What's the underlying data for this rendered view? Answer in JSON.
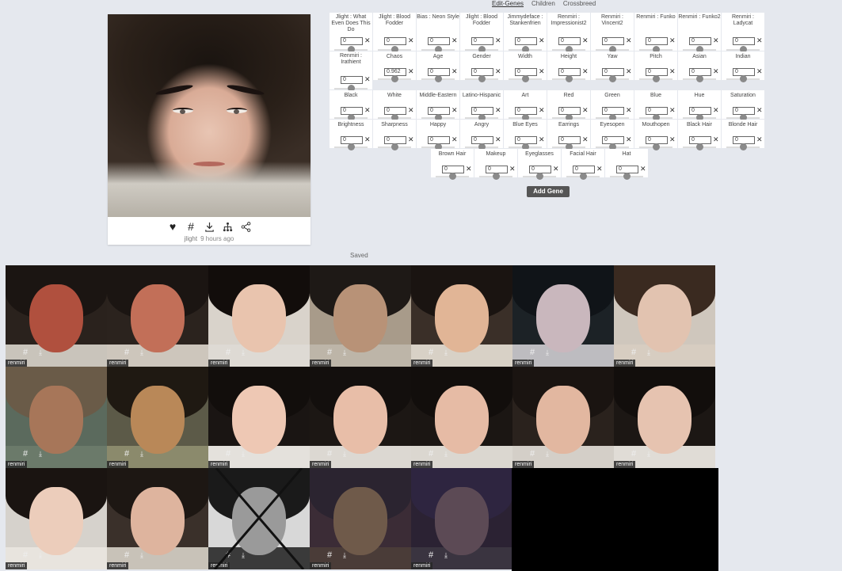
{
  "tabs": [
    {
      "label": "Edit-Genes",
      "active": true
    },
    {
      "label": "Children",
      "active": false
    },
    {
      "label": "Crossbreed",
      "active": false
    }
  ],
  "card": {
    "user": "jlight",
    "time": "9 hours ago",
    "icons": [
      "heart-icon",
      "hash-icon",
      "download-icon",
      "tree-icon",
      "share-icon"
    ]
  },
  "genes": {
    "row1": [
      {
        "label": "Jlight : What Even Does This Do",
        "value": "0",
        "knob": 0.5
      },
      {
        "label": "Jlight : Blood Fodder",
        "value": "0",
        "knob": 0.5
      },
      {
        "label": "Bias : Neon Style",
        "value": "0",
        "knob": 0.5
      },
      {
        "label": "Jlight : Blood Fodder",
        "value": "0",
        "knob": 0.5
      },
      {
        "label": "Jimmydeface : Stankenfrien",
        "value": "0",
        "knob": 0.5
      },
      {
        "label": "Renmiri : Impressionist2",
        "value": "0",
        "knob": 0.5
      },
      {
        "label": "Renmiri : Vincent2",
        "value": "0",
        "knob": 0.5
      },
      {
        "label": "Renmiri : Funko",
        "value": "0",
        "knob": 0.5
      },
      {
        "label": "Renmiri : Funko2",
        "value": "0",
        "knob": 0.5
      },
      {
        "label": "Renmiri : Ladycat",
        "value": "0",
        "knob": 0.5
      }
    ],
    "row2": [
      {
        "label": "Renmiri : Irathient",
        "value": "0",
        "knob": 0.5
      },
      {
        "label": "Chaos",
        "value": "0.962",
        "knob": 0.5
      },
      {
        "label": "Age",
        "value": "0",
        "knob": 0.5
      },
      {
        "label": "Gender",
        "value": "0",
        "knob": 0.5
      },
      {
        "label": "Width",
        "value": "0",
        "knob": 0.5
      },
      {
        "label": "Height",
        "value": "0",
        "knob": 0.5
      },
      {
        "label": "Yaw",
        "value": "0",
        "knob": 0.5
      },
      {
        "label": "Pitch",
        "value": "0",
        "knob": 0.5
      },
      {
        "label": "Asian",
        "value": "0",
        "knob": 0.5
      },
      {
        "label": "Indian",
        "value": "0",
        "knob": 0.5
      }
    ],
    "row3": [
      {
        "label": "Black",
        "value": "0",
        "knob": 0.5
      },
      {
        "label": "White",
        "value": "0",
        "knob": 0.5
      },
      {
        "label": "Middle-Eastern",
        "value": "0",
        "knob": 0.5
      },
      {
        "label": "Latino-Hispanic",
        "value": "0",
        "knob": 0.5
      },
      {
        "label": "Art",
        "value": "0",
        "knob": 0.5
      },
      {
        "label": "Red",
        "value": "0",
        "knob": 0.5
      },
      {
        "label": "Green",
        "value": "0",
        "knob": 0.5
      },
      {
        "label": "Blue",
        "value": "0",
        "knob": 0.5
      },
      {
        "label": "Hue",
        "value": "0",
        "knob": 0.5
      },
      {
        "label": "Saturation",
        "value": "0",
        "knob": 0.5
      }
    ],
    "row4": [
      {
        "label": "Brightness",
        "value": "0",
        "knob": 0.5
      },
      {
        "label": "Sharpness",
        "value": "0",
        "knob": 0.5
      },
      {
        "label": "Happy",
        "value": "0",
        "knob": 0.5
      },
      {
        "label": "Angry",
        "value": "0",
        "knob": 0.5
      },
      {
        "label": "Blue Eyes",
        "value": "0",
        "knob": 0.5
      },
      {
        "label": "Earrings",
        "value": "0",
        "knob": 0.5
      },
      {
        "label": "Eyesopen",
        "value": "0",
        "knob": 0.5
      },
      {
        "label": "Mouthopen",
        "value": "0",
        "knob": 0.5
      },
      {
        "label": "Black Hair",
        "value": "0",
        "knob": 0.5
      },
      {
        "label": "Blonde Hair",
        "value": "0",
        "knob": 0.5
      }
    ],
    "row5": [
      {
        "label": "Brown Hair",
        "value": "0",
        "knob": 0.5
      },
      {
        "label": "Makeup",
        "value": "0",
        "knob": 0.5
      },
      {
        "label": "Eyeglasses",
        "value": "0",
        "knob": 0.5
      },
      {
        "label": "Facial Hair",
        "value": "0",
        "knob": 0.5
      },
      {
        "label": "Hat",
        "value": "0",
        "knob": 0.5
      }
    ]
  },
  "add_gene_label": "Add Gene",
  "saved_label": "Saved",
  "saved": [
    {
      "user": "renmiri",
      "skin": "#b0503e",
      "hair": "#1b1512",
      "body": "#c9c4bb",
      "bg": "#2a221d"
    },
    {
      "user": "renmiri",
      "skin": "#c26f58",
      "hair": "#1b1512",
      "body": "#cdc6bc",
      "bg": "#2b231e"
    },
    {
      "user": "renmiri",
      "skin": "#e9c4ae",
      "hair": "#120d0b",
      "body": "#dedad4",
      "bg": "#d9d3cb"
    },
    {
      "user": "renmiri",
      "skin": "#b89277",
      "hair": "#1e1916",
      "body": "#bdb5a8",
      "bg": "#a89b8a"
    },
    {
      "user": "renmiri",
      "skin": "#e1b596",
      "hair": "#1a1411",
      "body": "#d8d1c6",
      "bg": "#3a2f28"
    },
    {
      "user": "renmiri",
      "skin": "#c9b7bd",
      "hair": "#101418",
      "body": "#bdbcc0",
      "bg": "#1c2226"
    },
    {
      "user": "renmiri",
      "skin": "#e2c3b0",
      "hair": "#3a2a20",
      "body": "#d7cdc1",
      "bg": "#cfc7bd"
    },
    {
      "user": "renmiri",
      "skin": "#a77659",
      "hair": "#6a5b48",
      "body": "#6b7a6a",
      "bg": "#5b6a5d"
    },
    {
      "user": "renmiri",
      "skin": "#b98858",
      "hair": "#1f1912",
      "body": "#8b8a6c",
      "bg": "#5c5a48"
    },
    {
      "user": "renmiri",
      "skin": "#eec8b4",
      "hair": "#120e0c",
      "body": "#e4e1dc",
      "bg": "#1a1513"
    },
    {
      "user": "renmiri",
      "skin": "#e8bea8",
      "hair": "#130f0d",
      "body": "#dcd8d2",
      "bg": "#1c1714"
    },
    {
      "user": "renmiri",
      "skin": "#e6bba5",
      "hair": "#120e0c",
      "body": "#dbd7d0",
      "bg": "#1b1613"
    },
    {
      "user": "renmiri",
      "skin": "#e2b7a0",
      "hair": "#1a1411",
      "body": "#d4cfc8",
      "bg": "#2a221d"
    },
    {
      "user": "renmiri",
      "skin": "#e6c3b0",
      "hair": "#120e0c",
      "body": "#e0dcd6",
      "bg": "#1c1714"
    },
    {
      "user": "renmiri",
      "skin": "#eccdbb",
      "hair": "#1a1411",
      "body": "#e8e4de",
      "bg": "#d6d2cc"
    },
    {
      "user": "renmiri",
      "skin": "#deb49e",
      "hair": "#1d1713",
      "body": "#c8c2b8",
      "bg": "#3a302a"
    },
    {
      "user": "renmiri",
      "skin": "#9a9a9a",
      "hair": "#1a1a1a",
      "body": "#3a3a3a",
      "bg": "#d8d8d8",
      "crossed": true
    },
    {
      "user": "renmiri",
      "skin": "#6f5a4a",
      "hair": "#2b2430",
      "body": "#4a3c38",
      "bg": "#3b2c36"
    },
    {
      "user": "renmiri",
      "skin": "#5c4a55",
      "hair": "#2e2540",
      "body": "#3a3440",
      "bg": "#2b2233"
    }
  ]
}
